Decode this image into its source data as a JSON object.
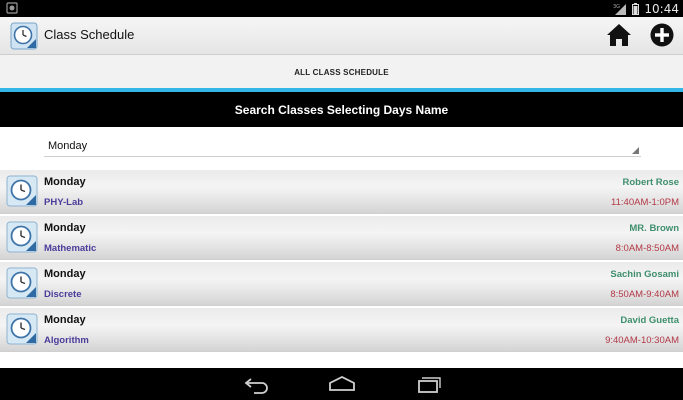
{
  "status_bar": {
    "time": "10:44",
    "icons": [
      "notification-icon",
      "signal-3g-icon",
      "battery-icon"
    ]
  },
  "action_bar": {
    "app_title": "Class Schedule",
    "icons": [
      "app-clock-icon",
      "home-icon",
      "add-circle-icon"
    ]
  },
  "tabs": [
    {
      "label": "ALL CLASS SCHEDULE",
      "selected": true
    }
  ],
  "search": {
    "header": "Search Classes Selecting Days Name",
    "selected_day": "Monday"
  },
  "classes": [
    {
      "day": "Monday",
      "subject": "PHY-Lab",
      "teacher": "Robert Rose",
      "time": "11:40AM-1:0PM"
    },
    {
      "day": "Monday",
      "subject": "Mathematic",
      "teacher": "MR. Brown",
      "time": "8:0AM-8:50AM"
    },
    {
      "day": "Monday",
      "subject": "Discrete",
      "teacher": "Sachin Gosami",
      "time": "8:50AM-9:40AM"
    },
    {
      "day": "Monday",
      "subject": "Algorithm",
      "teacher": "David Guetta",
      "time": "9:40AM-10:30AM"
    }
  ],
  "colors": {
    "tab_indicator": "#33b5e5",
    "subject_text": "#4b3c9a",
    "teacher_text": "#3f8f6e",
    "time_text": "#b23846"
  },
  "nav_bar": {
    "icons": [
      "back-icon",
      "home-nav-icon",
      "recent-apps-icon"
    ]
  }
}
